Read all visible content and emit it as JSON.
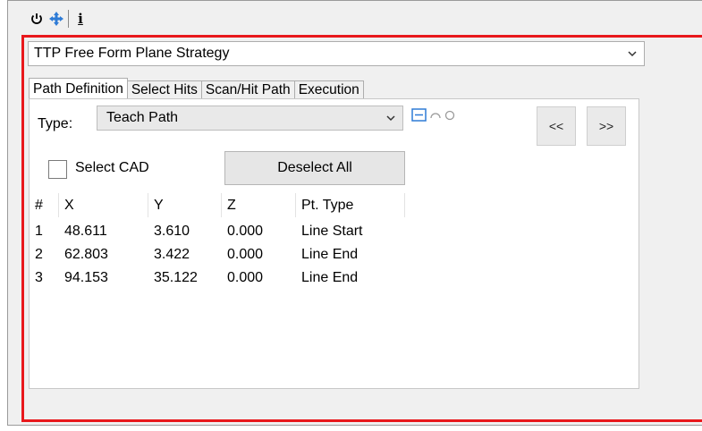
{
  "toolbar": {
    "icons": [
      "power-icon",
      "move-icon",
      "info-icon"
    ],
    "info_glyph": "i"
  },
  "strategy": {
    "selected": "TTP Free Form Plane Strategy"
  },
  "tabs": [
    {
      "label": "Path Definition",
      "active": true
    },
    {
      "label": "Select Hits",
      "active": false
    },
    {
      "label": "Scan/Hit Path",
      "active": false
    },
    {
      "label": "Execution",
      "active": false
    }
  ],
  "type": {
    "label": "Type:",
    "selected": "Teach Path"
  },
  "nav": {
    "prev_label": "<<",
    "next_label": ">>"
  },
  "select_cad": {
    "label": "Select CAD",
    "checked": false
  },
  "deselect_all": {
    "label": "Deselect All"
  },
  "table": {
    "columns": [
      "#",
      "X",
      "Y",
      "Z",
      "Pt. Type"
    ],
    "rows": [
      [
        "1",
        "48.611",
        "3.610",
        "0.000",
        "Line Start"
      ],
      [
        "2",
        "62.803",
        "3.422",
        "0.000",
        "Line End"
      ],
      [
        "3",
        "94.153",
        "35.122",
        "0.000",
        "Line End"
      ]
    ]
  },
  "colors": {
    "highlight_border": "#e8181c",
    "accent_blue": "#2e7bd6"
  }
}
